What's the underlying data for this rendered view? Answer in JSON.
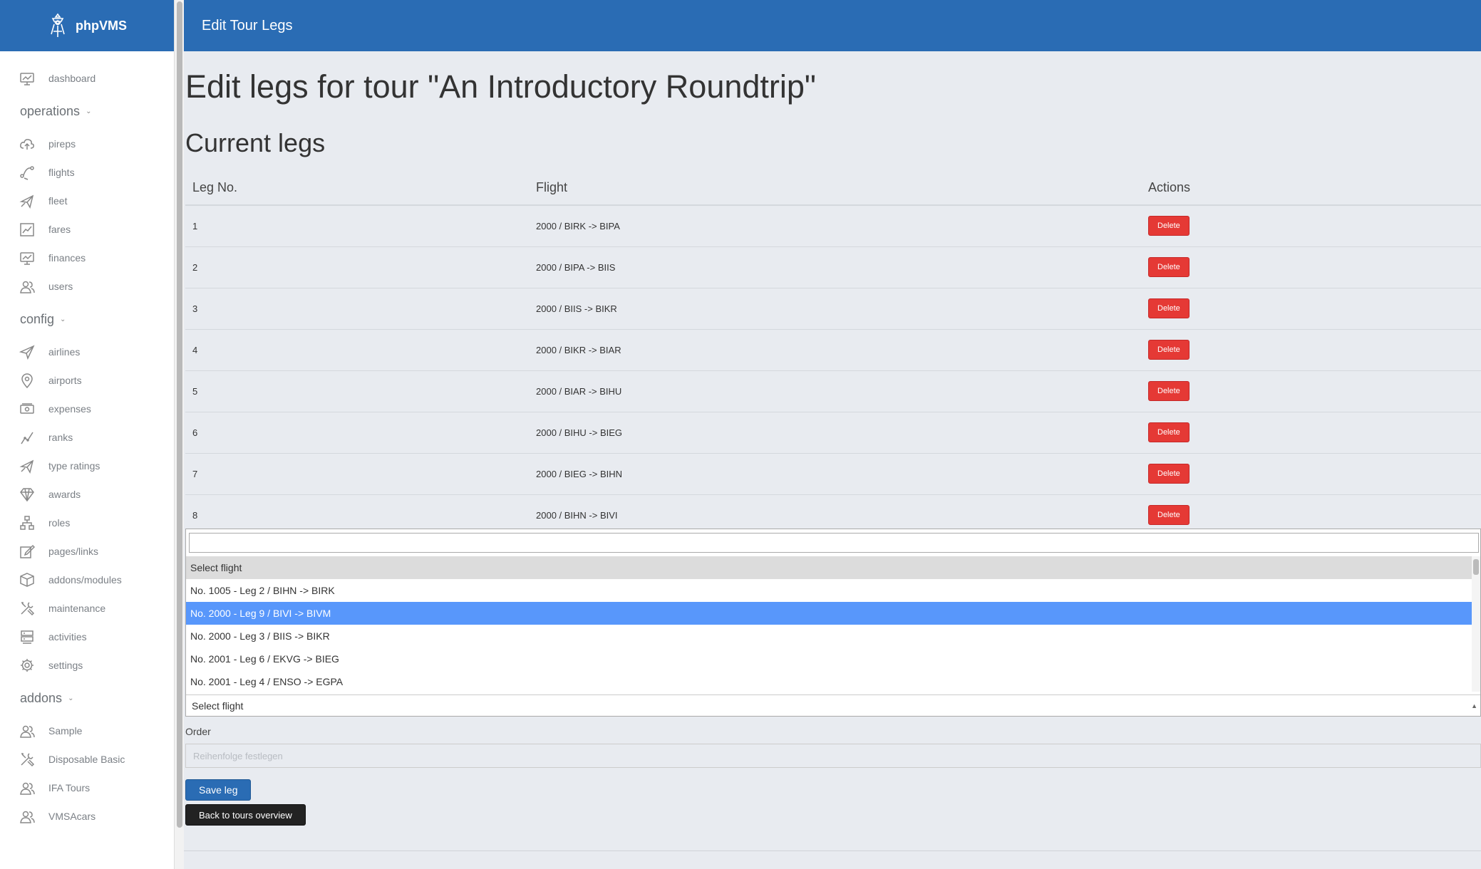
{
  "brand": {
    "name": "phpVMS"
  },
  "topbar": {
    "title": "Edit Tour Legs"
  },
  "sidebar": {
    "groups": [
      {
        "items": [
          {
            "label": "dashboard",
            "icon": "dashboard-icon"
          }
        ]
      },
      {
        "section": "operations",
        "items": [
          {
            "label": "pireps",
            "icon": "cloud-upload-icon"
          },
          {
            "label": "flights",
            "icon": "route-icon"
          },
          {
            "label": "fleet",
            "icon": "plane-icon"
          },
          {
            "label": "fares",
            "icon": "chart-icon"
          },
          {
            "label": "finances",
            "icon": "presentation-icon"
          },
          {
            "label": "users",
            "icon": "users-icon"
          }
        ]
      },
      {
        "section": "config",
        "items": [
          {
            "label": "airlines",
            "icon": "paper-plane-icon"
          },
          {
            "label": "airports",
            "icon": "map-pin-icon"
          },
          {
            "label": "expenses",
            "icon": "money-icon"
          },
          {
            "label": "ranks",
            "icon": "graph-icon"
          },
          {
            "label": "type ratings",
            "icon": "plane-icon"
          },
          {
            "label": "awards",
            "icon": "diamond-icon"
          },
          {
            "label": "roles",
            "icon": "hierarchy-icon"
          },
          {
            "label": "pages/links",
            "icon": "edit-icon"
          },
          {
            "label": "addons/modules",
            "icon": "box-icon"
          },
          {
            "label": "maintenance",
            "icon": "tools-icon"
          },
          {
            "label": "activities",
            "icon": "server-icon"
          },
          {
            "label": "settings",
            "icon": "gear-icon"
          }
        ]
      },
      {
        "section": "addons",
        "items": [
          {
            "label": "Sample",
            "icon": "users-icon"
          },
          {
            "label": "Disposable Basic",
            "icon": "tools-icon"
          },
          {
            "label": "IFA Tours",
            "icon": "users-icon"
          },
          {
            "label": "VMSAcars",
            "icon": "users-icon"
          }
        ]
      }
    ]
  },
  "page": {
    "title": "Edit legs for tour \"An Introductory Roundtrip\"",
    "current_legs_title": "Current legs"
  },
  "legs_table": {
    "headers": {
      "leg": "Leg No.",
      "flight": "Flight",
      "actions": "Actions"
    },
    "delete_label": "Delete",
    "rows": [
      {
        "leg": "1",
        "flight": "2000 / BIRK -> BIPA"
      },
      {
        "leg": "2",
        "flight": "2000 / BIPA -> BIIS"
      },
      {
        "leg": "3",
        "flight": "2000 / BIIS -> BIKR"
      },
      {
        "leg": "4",
        "flight": "2000 / BIKR -> BIAR"
      },
      {
        "leg": "5",
        "flight": "2000 / BIAR -> BIHU"
      },
      {
        "leg": "6",
        "flight": "2000 / BIHU -> BIEG"
      },
      {
        "leg": "7",
        "flight": "2000 / BIEG -> BIHN"
      },
      {
        "leg": "8",
        "flight": "2000 / BIHN -> BIVI"
      }
    ]
  },
  "flight_select": {
    "search_value": "",
    "options": [
      {
        "label": "Select flight",
        "state": "header"
      },
      {
        "label": "No. 1005 - Leg 2 / BIHN -> BIRK",
        "state": ""
      },
      {
        "label": "No. 2000 - Leg 9 / BIVI -> BIVM",
        "state": "selected"
      },
      {
        "label": "No. 2000 - Leg 3 / BIIS -> BIKR",
        "state": ""
      },
      {
        "label": "No. 2001 - Leg 6 / EKVG -> BIEG",
        "state": ""
      },
      {
        "label": "No. 2001 - Leg 4 / ENSO -> EGPA",
        "state": ""
      }
    ],
    "current": "Select flight"
  },
  "order": {
    "label": "Order",
    "placeholder": "Reihenfolge festlegen",
    "value": ""
  },
  "buttons": {
    "save": "Save leg",
    "back": "Back to tours overview"
  },
  "colors": {
    "primary": "#2a6cb4",
    "danger": "#e53935",
    "selected_option": "#5897fb",
    "background": "#e8ebf0"
  }
}
